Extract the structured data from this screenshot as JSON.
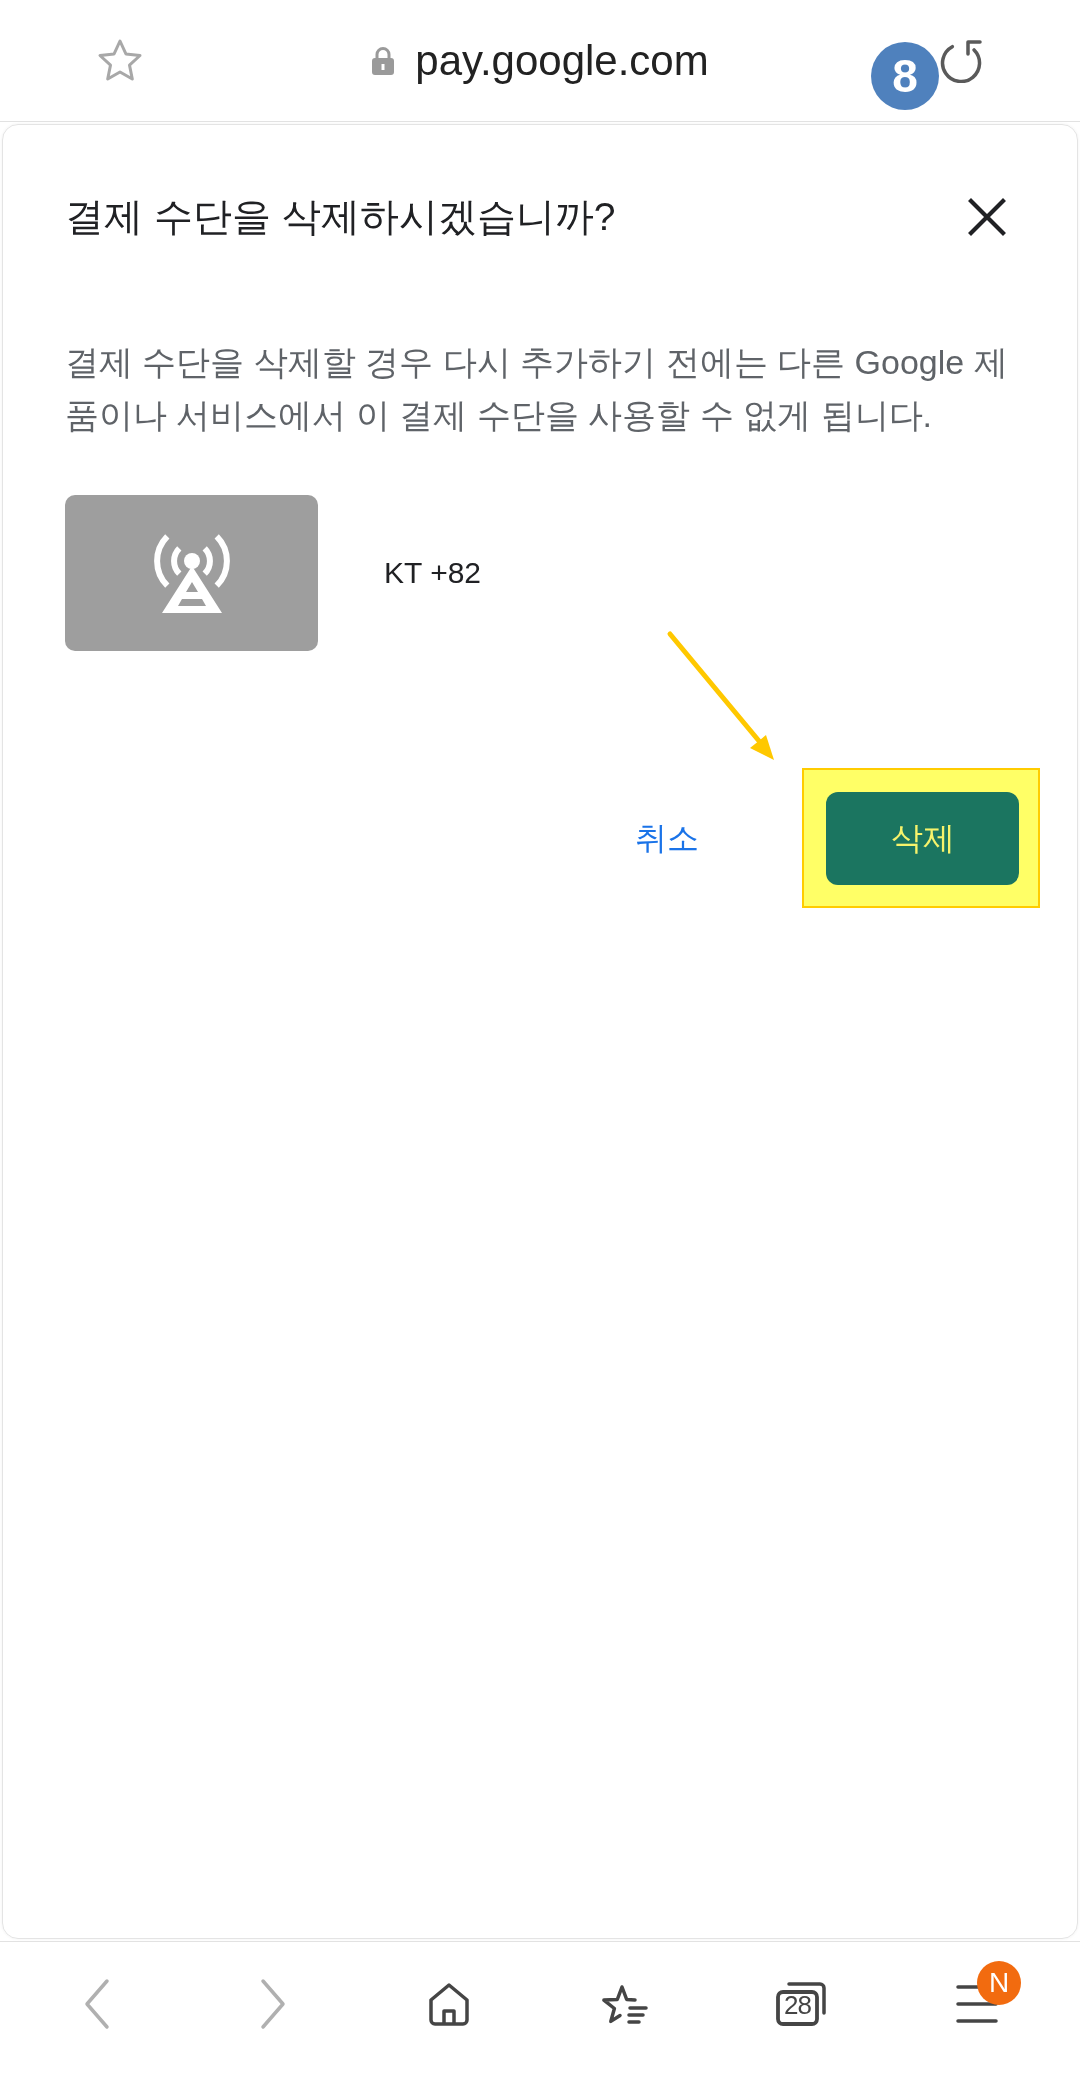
{
  "toolbar": {
    "url": "pay.google.com",
    "secure": true
  },
  "annotation": {
    "step": "8",
    "arrow": true
  },
  "dialog": {
    "title": "결제 수단을 삭제하시겠습니까?",
    "message": "결제 수단을 삭제할 경우 다시 추가하기 전에는 다른 Google 제품이나 서비스에서 이 결제 수단을 사용할 수 없게 됩니다.",
    "payment_method": {
      "name": "KT +82"
    },
    "buttons": [
      {
        "label": "취소",
        "kind": "text",
        "highlighted": false
      },
      {
        "label": "삭제",
        "kind": "filled",
        "highlighted": true
      }
    ]
  },
  "bottom_nav": [
    {
      "kind": "back",
      "disabled": true
    },
    {
      "kind": "forward",
      "disabled": true
    },
    {
      "kind": "home",
      "disabled": false
    },
    {
      "kind": "bookmarks",
      "disabled": false
    },
    {
      "kind": "tabs",
      "disabled": false,
      "count": "28"
    },
    {
      "kind": "menu",
      "disabled": false,
      "badge": "N"
    }
  ]
}
